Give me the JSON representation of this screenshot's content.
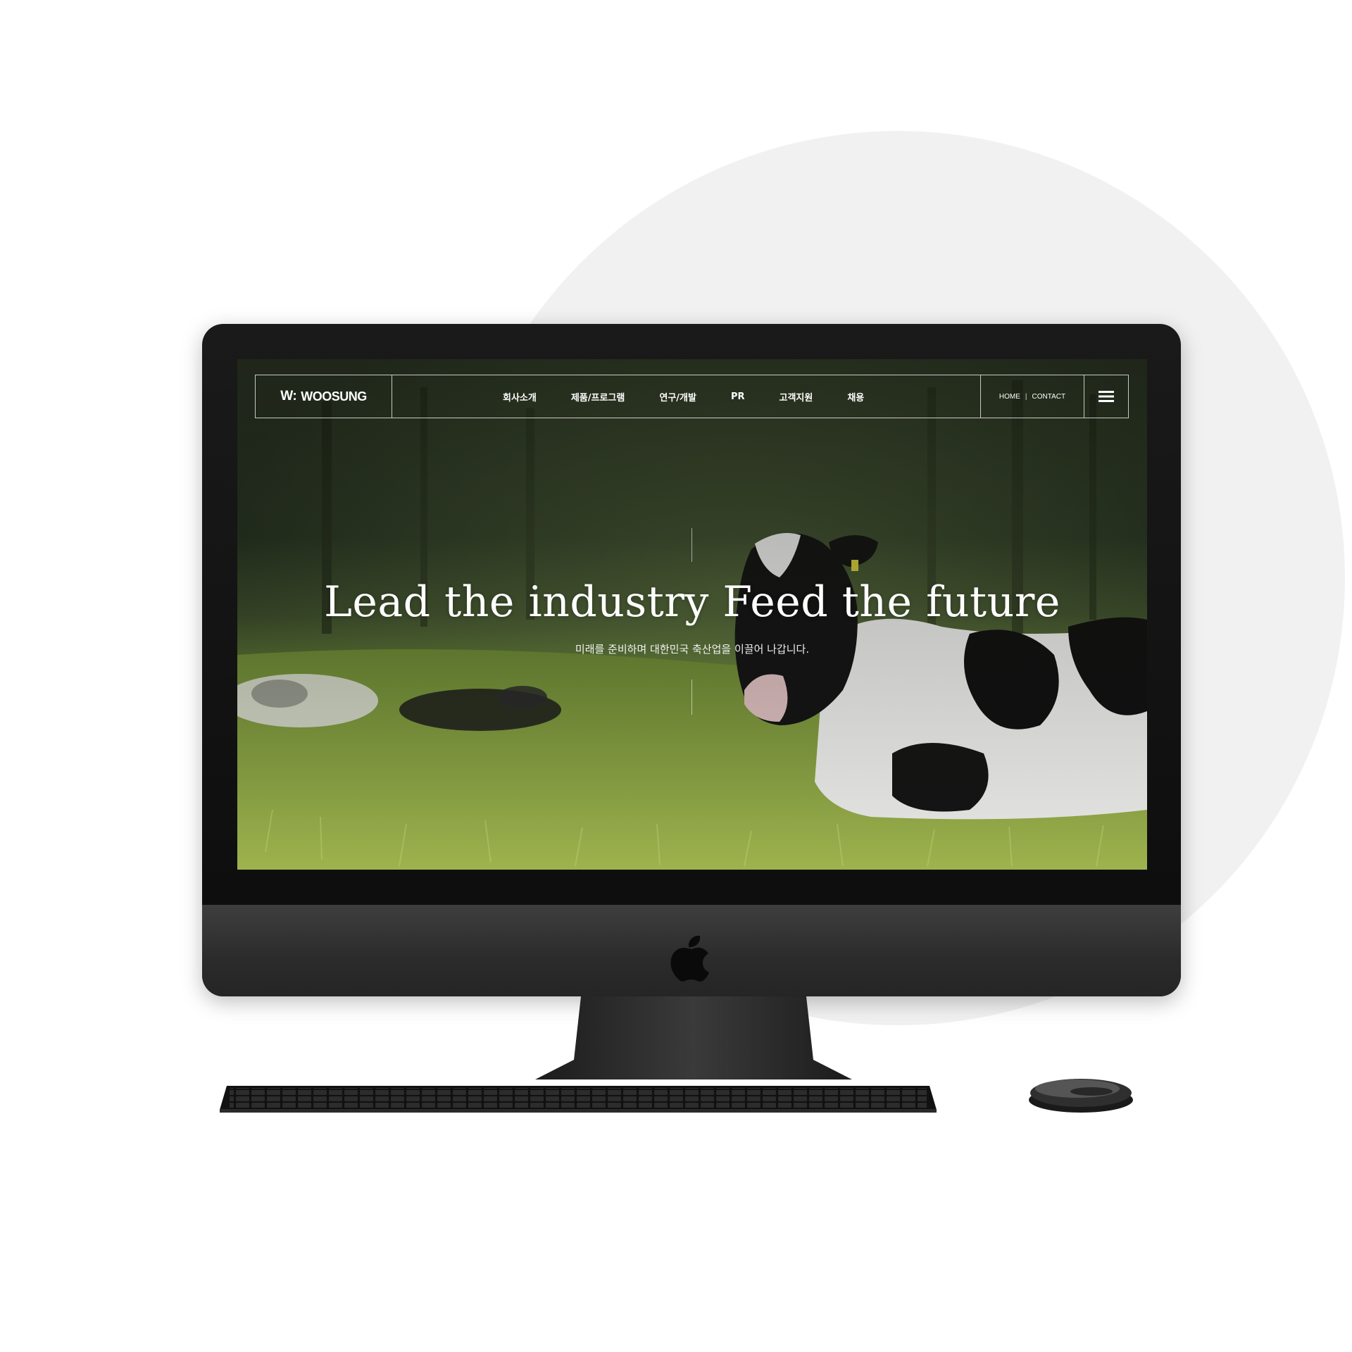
{
  "site": {
    "logo_mark": "W:",
    "logo_text": "WOOSUNG",
    "menu": [
      {
        "label": "회사소개"
      },
      {
        "label": "제품/프로그램"
      },
      {
        "label": "연구/개발"
      },
      {
        "label": "PR"
      },
      {
        "label": "고객지원"
      },
      {
        "label": "채용"
      }
    ],
    "util_home": "HOME",
    "util_separator": "|",
    "util_contact": "CONTACT"
  },
  "hero": {
    "title": "Lead the industry Feed the future",
    "subtitle": "미래를 준비하며 대한민국 축산업을 이끌어 나갑니다."
  },
  "icons": {
    "menu": "hamburger-icon",
    "device_logo": "apple-logo-icon"
  },
  "colors": {
    "background": "#ffffff",
    "circle": "#f1f1f1",
    "device": "#1a1a1a",
    "nav_text": "#ffffff"
  }
}
